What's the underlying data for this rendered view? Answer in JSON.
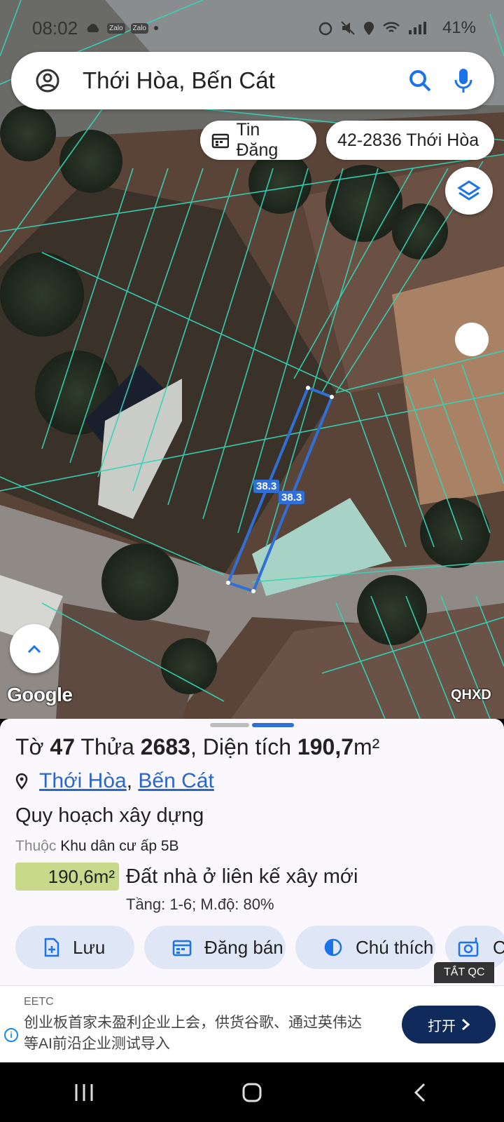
{
  "status": {
    "time": "08:02",
    "battery": "41%"
  },
  "search": {
    "query": "Thới Hòa, Bến Cát"
  },
  "chips": {
    "news": "Tin Đăng",
    "parcel": "42-2836 Thới Hòa"
  },
  "map": {
    "measure_1": "38.3",
    "measure_2": "38.3",
    "google": "Google",
    "layer_label": "QHXD"
  },
  "parcel": {
    "to_label": "Tờ",
    "to_value": "47",
    "thua_label": "Thửa",
    "thua_value": "2683",
    "area_label": ", Diện tích",
    "area_value": "190,7",
    "area_unit": "m²",
    "commune": "Thới Hòa",
    "district": "Bến Cát",
    "comma": ",",
    "planning_title": "Quy hoạch xây dựng",
    "belongs_label": "Thuộc",
    "belongs_value": "Khu dân cư ấp 5B",
    "zone_area": "190,6m²",
    "land_type": "Đất nhà ở liên kế xây mới",
    "floors": "Tầng: 1-6; M.độ: 80%"
  },
  "actions": {
    "save": "Lưu",
    "post": "Đăng bán",
    "legend": "Chú thích",
    "more": "C"
  },
  "ad": {
    "close_label": "TẮT QC",
    "brand": "EETC",
    "text": "创业板首家未盈利企业上会，供货谷歌、通过英伟达等AI前沿企业测试导入",
    "button": "打开"
  },
  "colors": {
    "parcel_lines": "#35d3b6",
    "selected": "#2f6fd6",
    "badge": "#c8d98b"
  }
}
